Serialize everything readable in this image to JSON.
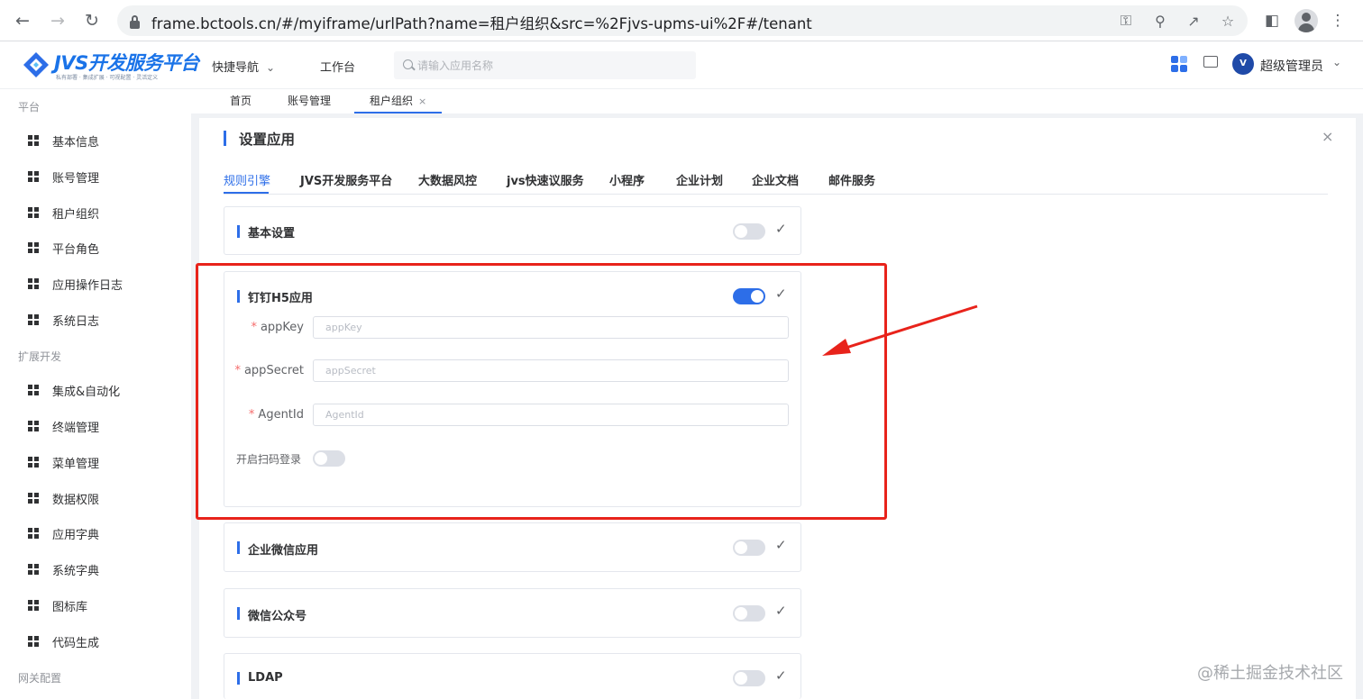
{
  "browser": {
    "url": "frame.bctools.cn/#/myiframe/urlPath?name=租户组织&src=%2Fjvs-upms-ui%2F#/tenant"
  },
  "header": {
    "logo_title": "JVS开发服务平台",
    "logo_subtitle": "私有部署 · 集成扩展 · 可视配置 · 灵活定义",
    "quick_nav": "快捷导航",
    "workbench": "工作台",
    "search_placeholder": "请输入应用名称",
    "avatar_text": "V",
    "user_name": "超级管理员"
  },
  "sidebar": {
    "groups": [
      {
        "title": "平台",
        "items": [
          "基本信息",
          "账号管理",
          "租户组织",
          "平台角色",
          "应用操作日志",
          "系统日志"
        ]
      },
      {
        "title": "扩展开发",
        "items": [
          "集成&自动化",
          "终端管理",
          "菜单管理",
          "数据权限",
          "应用字典",
          "系统字典",
          "图标库",
          "代码生成"
        ]
      },
      {
        "title": "网关配置",
        "items": []
      }
    ]
  },
  "page_tabs": [
    {
      "label": "首页"
    },
    {
      "label": "账号管理"
    },
    {
      "label": "租户组织",
      "active": true
    }
  ],
  "panel": {
    "title": "设置应用",
    "category_tabs": [
      "规则引擎",
      "JVS开发服务平台",
      "大数据风控",
      "jvs快速议服务",
      "小程序",
      "企业计划",
      "企业文档",
      "邮件服务"
    ],
    "cards": [
      {
        "title": "基本设置",
        "enabled": false
      },
      {
        "title": "钉钉H5应用",
        "enabled": true,
        "fields": [
          {
            "label": "appKey",
            "required": true,
            "placeholder": "appKey",
            "value": ""
          },
          {
            "label": "appSecret",
            "required": true,
            "placeholder": "appSecret",
            "value": ""
          },
          {
            "label": "AgentId",
            "required": true,
            "placeholder": "AgentId",
            "value": ""
          }
        ],
        "scan_login_label": "开启扫码登录",
        "scan_login_enabled": false
      },
      {
        "title": "企业微信应用",
        "enabled": false
      },
      {
        "title": "微信公众号",
        "enabled": false
      },
      {
        "title": "LDAP",
        "enabled": false
      }
    ]
  },
  "watermark": "@稀土掘金技术社区",
  "colors": {
    "accent": "#2d6ee8",
    "annotation_red": "#e8231b",
    "required": "#f56c6c"
  }
}
